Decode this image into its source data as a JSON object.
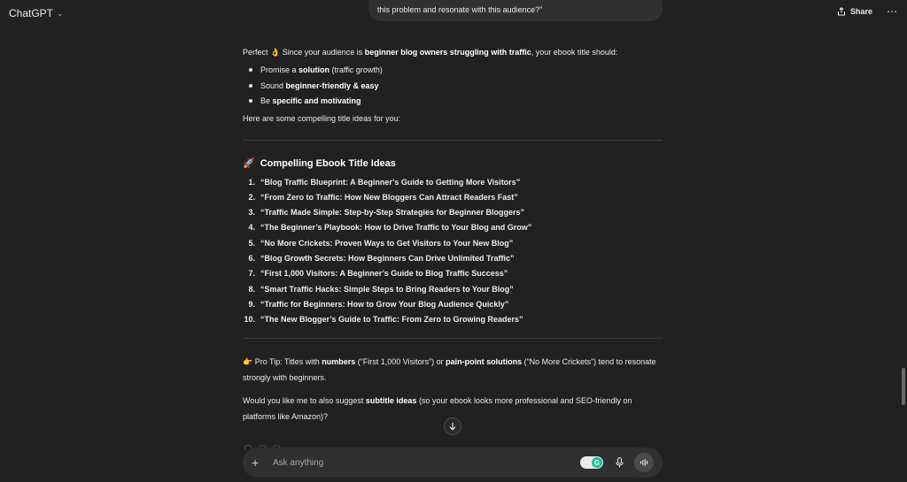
{
  "header": {
    "model_label": "ChatGPT",
    "share_label": "Share",
    "more_label": "⋯"
  },
  "user_message": {
    "visible_text": "this problem and resonate with this audience?\""
  },
  "answer": {
    "intro_prefix": "Perfect 👌 Since your audience is ",
    "intro_bold": "beginner blog owners struggling with traffic",
    "intro_suffix": ", your ebook title should:",
    "bullets": [
      {
        "prefix": "Promise a ",
        "bold": "solution",
        "suffix": " (traffic growth)"
      },
      {
        "prefix": "Sound ",
        "bold": "beginner-friendly & easy",
        "suffix": ""
      },
      {
        "prefix": "Be ",
        "bold": "specific and motivating",
        "suffix": ""
      }
    ],
    "lead_in": "Here are some compelling title ideas for you:",
    "section_icon": "🚀",
    "section_title": "Compelling Ebook Title Ideas",
    "titles": [
      {
        "num": "1.",
        "text": "“Blog Traffic Blueprint: A Beginner’s Guide to Getting More Visitors”"
      },
      {
        "num": "2.",
        "text": "“From Zero to Traffic: How New Bloggers Can Attract Readers Fast”"
      },
      {
        "num": "3.",
        "text": "“Traffic Made Simple: Step-by-Step Strategies for Beginner Bloggers”"
      },
      {
        "num": "4.",
        "text": "“The Beginner’s Playbook: How to Drive Traffic to Your Blog and Grow”"
      },
      {
        "num": "5.",
        "text": "“No More Crickets: Proven Ways to Get Visitors to Your New Blog”"
      },
      {
        "num": "6.",
        "text": "“Blog Growth Secrets: How Beginners Can Drive Unlimited Traffic”"
      },
      {
        "num": "7.",
        "text": "“First 1,000 Visitors: A Beginner’s Guide to Blog Traffic Success”"
      },
      {
        "num": "8.",
        "text": "“Smart Traffic Hacks: Simple Steps to Bring Readers to Your Blog”"
      },
      {
        "num": "9.",
        "text": "“Traffic for Beginners: How to Grow Your Blog Audience Quickly”"
      },
      {
        "num": "10.",
        "text": "“The New Blogger’s Guide to Traffic: From Zero to Growing Readers”"
      }
    ],
    "tip": {
      "p1": "👉 Pro Tip: Titles with ",
      "b1": "numbers",
      "p2": " (“First 1,000 Visitors”) or ",
      "b2": "pain-point solutions",
      "p3": " (“No More Crickets”) tend to resonate strongly with beginners."
    },
    "followup": {
      "p1": "Would you like me to also suggest ",
      "b1": "subtitle ideas",
      "p2": " (so your ebook looks more professional and SEO-friendly on platforms like Amazon)?"
    }
  },
  "composer": {
    "placeholder": "Ask anything",
    "plus_label": "+",
    "grammarly_label": "G"
  }
}
